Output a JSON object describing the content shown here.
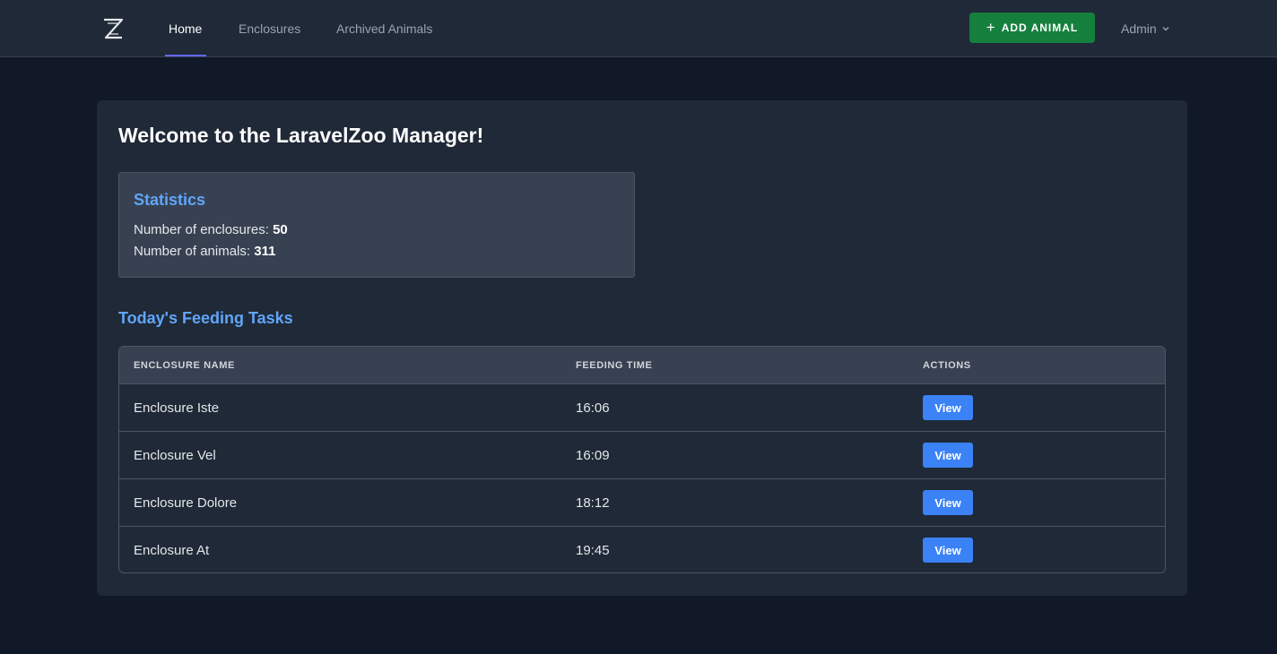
{
  "nav": {
    "logo_icon": "z-logo-icon",
    "links": [
      "Home",
      "Enclosures",
      "Archived Animals"
    ],
    "active": "Home",
    "add_button": "ADD ANIMAL",
    "user": "Admin"
  },
  "main": {
    "welcome": "Welcome to the LaravelZoo Manager!",
    "statistics": {
      "title": "Statistics",
      "enclosures_label": "Number of enclosures:",
      "enclosures_value": "50",
      "animals_label": "Number of animals:",
      "animals_value": "311"
    },
    "tasks_title": "Today's Feeding Tasks",
    "table": {
      "headers": [
        "ENCLOSURE NAME",
        "FEEDING TIME",
        "ACTIONS"
      ],
      "rows": [
        {
          "name": "Enclosure Iste",
          "time": "16:06",
          "action": "View"
        },
        {
          "name": "Enclosure Vel",
          "time": "16:09",
          "action": "View"
        },
        {
          "name": "Enclosure Dolore",
          "time": "18:12",
          "action": "View"
        },
        {
          "name": "Enclosure At",
          "time": "19:45",
          "action": "View"
        }
      ]
    }
  },
  "colors": {
    "background": "#111827",
    "panel": "#1f2937",
    "accent_blue": "#60a5fa",
    "add_button": "#15803d",
    "view_button": "#3b82f6",
    "nav_underline": "#6366f1"
  }
}
